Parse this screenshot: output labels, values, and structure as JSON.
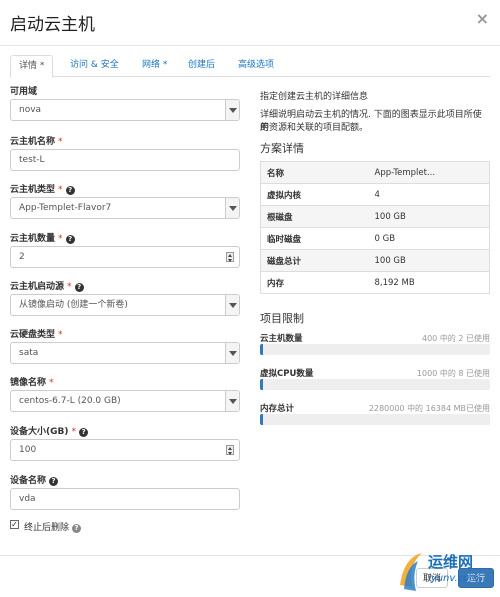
{
  "modal": {
    "title": "启动云主机"
  },
  "tabs": [
    "详情 *",
    "访问 & 安全",
    "网络 *",
    "创建后",
    "高级选项"
  ],
  "form": {
    "availability_zone": {
      "label": "可用域",
      "value": "nova"
    },
    "instance_name": {
      "label": "云主机名称",
      "value": "test-L"
    },
    "flavor": {
      "label": "云主机类型",
      "value": "App-Templet-Flavor7"
    },
    "count": {
      "label": "云主机数量",
      "value": "2"
    },
    "boot_source": {
      "label": "云主机启动源",
      "value": "从镜像启动 (创建一个新卷)"
    },
    "volume_type": {
      "label": "云硬盘类型",
      "value": "sata"
    },
    "image_name": {
      "label": "镜像名称",
      "value": "centos-6.7-L (20.0 GB)"
    },
    "device_size": {
      "label": "设备大小(GB)",
      "value": "100"
    },
    "device_name": {
      "label": "设备名称",
      "value": "vda"
    },
    "delete_on_terminate": {
      "label": "终止后删除",
      "checked": true
    },
    "required_mark": "*",
    "help_glyph": "?"
  },
  "info": {
    "heading": "指定创建云主机的详细信息",
    "desc_line1": "详细说明启动云主机的情况. 下面的图表显示此项目所使用",
    "desc_line2": "的资源和关联的项目配额。"
  },
  "flavor_details": {
    "title": "方案详情",
    "rows": [
      {
        "k": "名称",
        "v": "App-Templet..."
      },
      {
        "k": "虚拟内核",
        "v": "4"
      },
      {
        "k": "根磁盘",
        "v": "100 GB"
      },
      {
        "k": "临时磁盘",
        "v": "0 GB"
      },
      {
        "k": "磁盘总计",
        "v": "100 GB"
      },
      {
        "k": "内存",
        "v": "8,192 MB"
      }
    ]
  },
  "quota": {
    "title": "项目限制",
    "items": [
      {
        "label": "云主机数量",
        "used": "400 中的 2 已使用",
        "fraction": 0.005
      },
      {
        "label": "虚拟CPU数量",
        "used": "1000 中的 8 已使用",
        "fraction": 0.008
      },
      {
        "label": "内存总计",
        "used": "2280000 中的 16384 MB已使用",
        "fraction": 0.0072
      }
    ]
  },
  "footer": {
    "cancel": "取消",
    "launch": "运行"
  },
  "watermark": {
    "text": "运维网",
    "url": "iyunv.com"
  },
  "colors": {
    "primary": "#3a78b7",
    "link": "#1b75bb",
    "required": "#c9302c",
    "bar": "#337ab7"
  }
}
